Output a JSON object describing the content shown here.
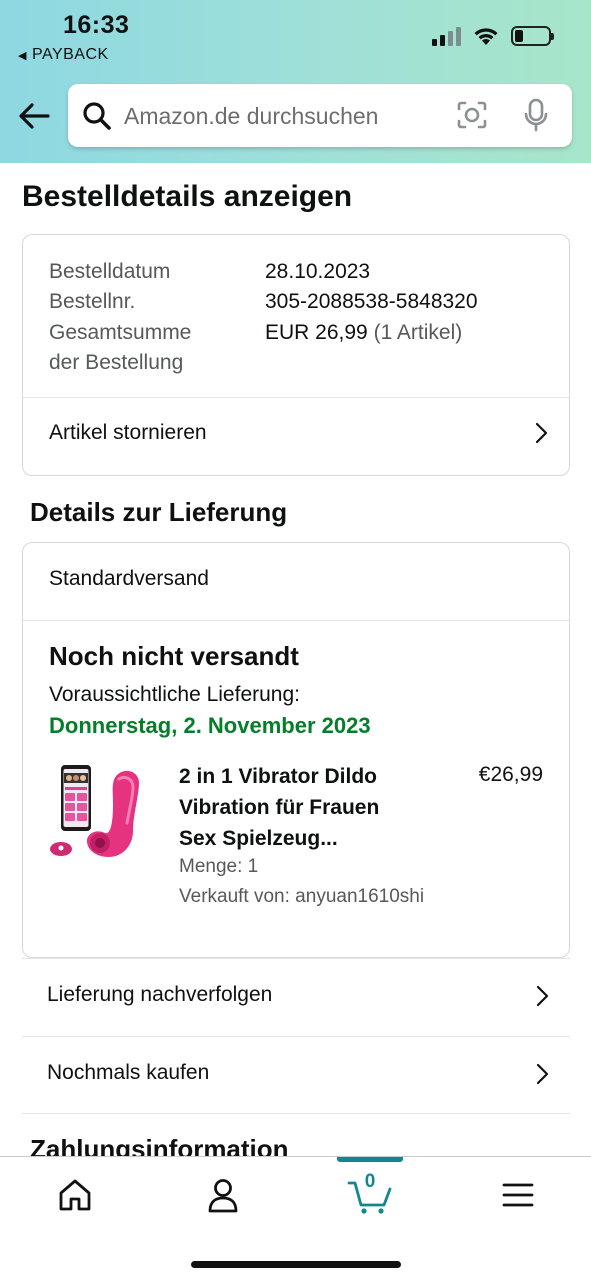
{
  "status_bar": {
    "time": "16:33",
    "back_app": "PAYBACK"
  },
  "search": {
    "placeholder": "Amazon.de durchsuchen"
  },
  "page": {
    "title": "Bestelldetails anzeigen"
  },
  "order_summary": {
    "date_label": "Bestelldatum",
    "date_value": "28.10.2023",
    "number_label": "Bestellnr.",
    "number_value": "305-2088538-5848320",
    "total_label_line1": "Gesamtsumme",
    "total_label_line2": "der Bestellung",
    "total_value": "EUR 26,99",
    "total_items": "(1 Artikel)",
    "cancel_link": "Artikel stornieren"
  },
  "delivery": {
    "section_title": "Details zur Lieferung",
    "method": "Standardversand",
    "status": "Noch nicht versandt",
    "estimate_label": "Voraussichtliche Lieferung:",
    "estimate_date": "Donnerstag, 2. November 2023",
    "estimate_color": "#067d29",
    "item": {
      "title_line1": "2 in 1 Vibrator Dildo",
      "title_line2": "Vibration für Frauen",
      "title_line3": "Sex Spielzeug...",
      "price": "€26,99",
      "quantity": "Menge: 1",
      "seller": "Verkauft von: anyuan1610shi"
    }
  },
  "actions": {
    "track": "Lieferung nachverfolgen",
    "buy_again": "Nochmals kaufen"
  },
  "next_section": {
    "title": "Zahlungsinformation"
  },
  "bottom_nav": {
    "cart_count": "0",
    "active_color": "#13868f"
  }
}
